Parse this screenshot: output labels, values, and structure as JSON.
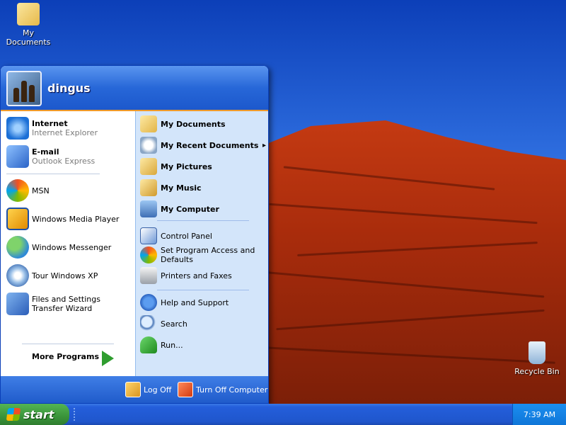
{
  "desktop": {
    "icons": [
      {
        "label": "My Documents",
        "icon": "folder-icon"
      },
      {
        "label": "Recycle Bin",
        "icon": "recycle-bin-icon"
      }
    ]
  },
  "start_menu": {
    "user": {
      "name": "dingus",
      "avatar": "chess-pieces-avatar"
    },
    "pinned": [
      {
        "title": "Internet",
        "subtitle": "Internet Explorer",
        "icon": "internet-explorer-icon"
      },
      {
        "title": "E-mail",
        "subtitle": "Outlook Express",
        "icon": "outlook-express-icon"
      }
    ],
    "recent": [
      {
        "label": "MSN",
        "icon": "msn-butterfly-icon"
      },
      {
        "label": "Windows Media Player",
        "icon": "media-player-icon"
      },
      {
        "label": "Windows Messenger",
        "icon": "messenger-icon"
      },
      {
        "label": "Tour Windows XP",
        "icon": "tour-xp-icon"
      },
      {
        "label": "Files and Settings Transfer Wizard",
        "icon": "transfer-wizard-icon"
      }
    ],
    "more_programs": "More Programs",
    "right_items": [
      {
        "label": "My Documents",
        "icon": "folder-icon"
      },
      {
        "label": "My Recent Documents",
        "icon": "recent-docs-icon",
        "submenu": "▸"
      },
      {
        "label": "My Pictures",
        "icon": "pictures-folder-icon"
      },
      {
        "label": "My Music",
        "icon": "music-folder-icon"
      },
      {
        "label": "My Computer",
        "icon": "computer-icon"
      },
      {
        "label": "Control Panel",
        "icon": "control-panel-icon"
      },
      {
        "label": "Set Program Access and Defaults",
        "icon": "program-access-icon"
      },
      {
        "label": "Printers and Faxes",
        "icon": "printer-icon"
      },
      {
        "label": "Help and Support",
        "icon": "help-icon"
      },
      {
        "label": "Search",
        "icon": "search-icon"
      },
      {
        "label": "Run...",
        "icon": "run-icon"
      }
    ],
    "footer": {
      "log_off": "Log Off",
      "turn_off": "Turn Off Computer"
    }
  },
  "taskbar": {
    "start_label": "start",
    "clock": "7:39 AM"
  },
  "colors": {
    "taskbar": "#245edb",
    "start_green": "#3a943a",
    "menu_header": "#2767d8",
    "menu_right_pane": "#d3e5fa",
    "separator_orange": "#ef9a2b"
  }
}
